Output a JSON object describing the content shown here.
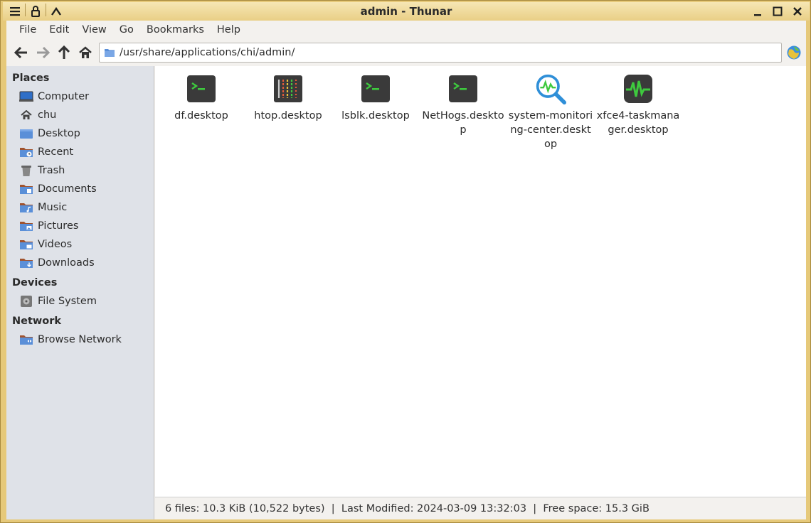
{
  "window": {
    "title": "admin - Thunar"
  },
  "menu": [
    "File",
    "Edit",
    "View",
    "Go",
    "Bookmarks",
    "Help"
  ],
  "address": {
    "path": "/usr/share/applications/chi/admin/"
  },
  "sidebar": {
    "places_title": "Places",
    "places": [
      {
        "label": "Computer",
        "icon": "computer-icon"
      },
      {
        "label": "chu",
        "icon": "home-icon"
      },
      {
        "label": "Desktop",
        "icon": "desktop-icon"
      },
      {
        "label": "Recent",
        "icon": "recent-icon"
      },
      {
        "label": "Trash",
        "icon": "trash-icon"
      },
      {
        "label": "Documents",
        "icon": "documents-folder-icon"
      },
      {
        "label": "Music",
        "icon": "music-folder-icon"
      },
      {
        "label": "Pictures",
        "icon": "pictures-folder-icon"
      },
      {
        "label": "Videos",
        "icon": "videos-folder-icon"
      },
      {
        "label": "Downloads",
        "icon": "downloads-folder-icon"
      }
    ],
    "devices_title": "Devices",
    "devices": [
      {
        "label": "File System",
        "icon": "drive-icon"
      }
    ],
    "network_title": "Network",
    "network": [
      {
        "label": "Browse Network",
        "icon": "network-folder-icon"
      }
    ]
  },
  "files": [
    {
      "name": "df.desktop",
      "icon": "terminal-icon"
    },
    {
      "name": "htop.desktop",
      "icon": "htop-icon"
    },
    {
      "name": "lsblk.desktop",
      "icon": "terminal-icon"
    },
    {
      "name": "NetHogs.desktop",
      "icon": "terminal-icon"
    },
    {
      "name": "system-monitoring-center.desktop",
      "icon": "system-monitor-icon"
    },
    {
      "name": "xfce4-taskmanager.desktop",
      "icon": "taskmanager-icon"
    }
  ],
  "status": {
    "text": "6 files: 10.3 KiB (10,522 bytes)  |  Last Modified: 2024-03-09 13:32:03  |  Free space: 15.3 GiB"
  },
  "colors": {
    "titlebar": "#e9cf86",
    "sidebar": "#dfe2e8",
    "folder_blue": "#5a8fd8",
    "terminal_green": "#3ec93e"
  }
}
